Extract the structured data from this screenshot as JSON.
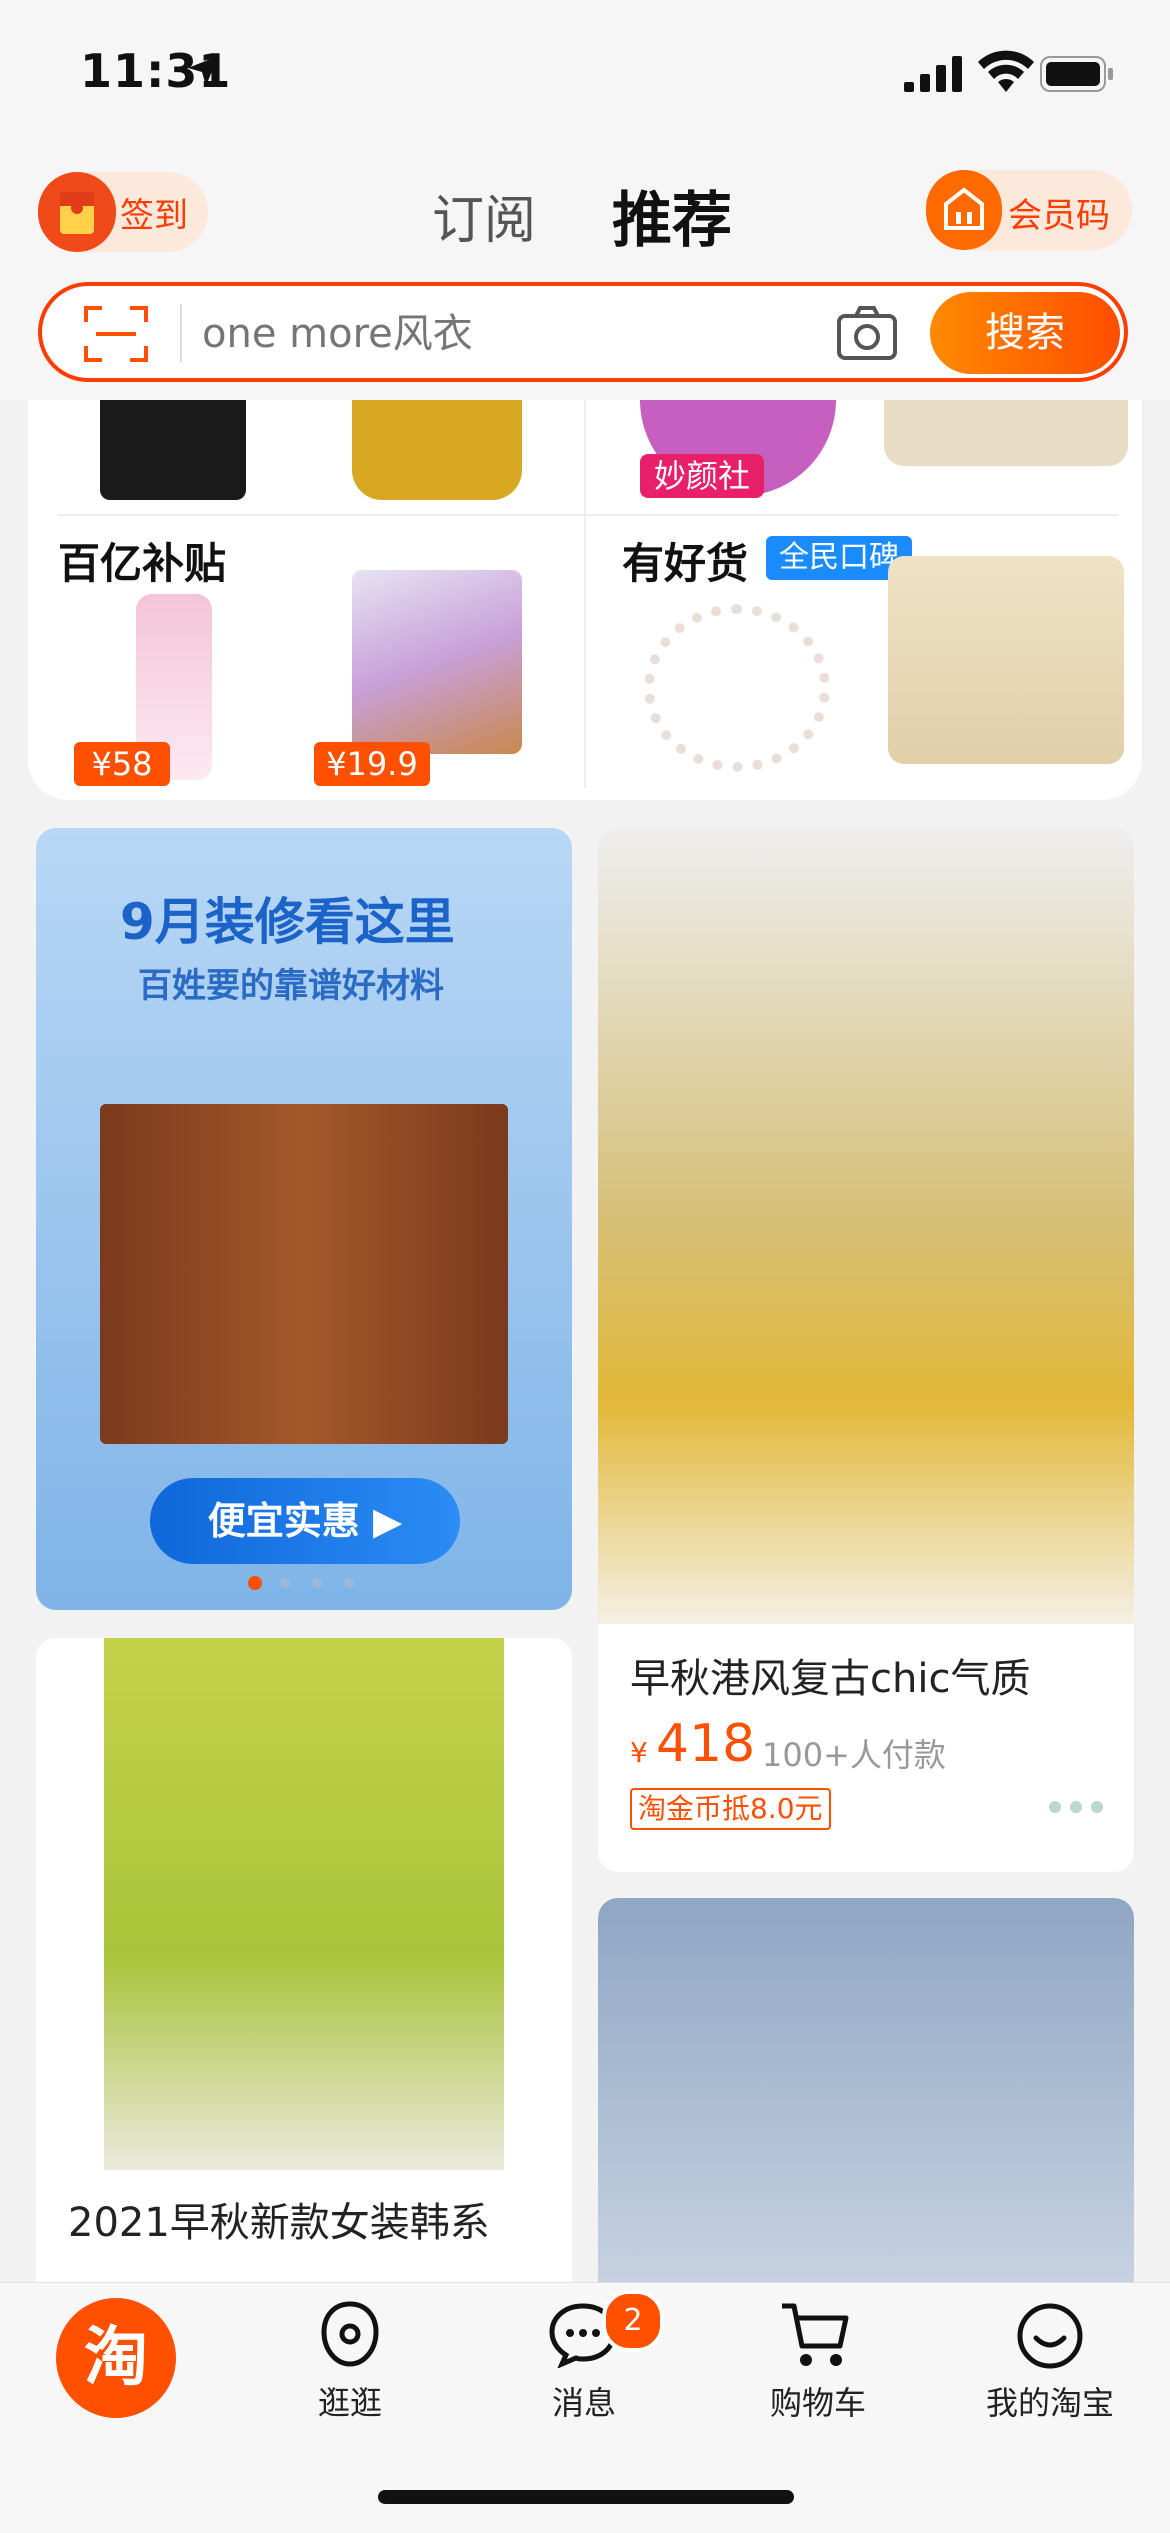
{
  "status_bar": {
    "time": "11:31"
  },
  "header": {
    "sign_in_label": "签到",
    "tabs": [
      {
        "label": "订阅"
      },
      {
        "label": "推荐"
      }
    ],
    "member_code_label": "会员码"
  },
  "search": {
    "placeholder": "one more风衣",
    "button_label": "搜索"
  },
  "top_sections": {
    "miaoyan_badge": "妙颜社",
    "subsidy": {
      "title": "百亿补贴",
      "prices": [
        "¥58",
        "¥19.9"
      ]
    },
    "good_goods": {
      "title": "有好货",
      "badge": "全民口碑"
    }
  },
  "banner": {
    "title": "9月装修看这里",
    "subtitle": "百姓要的靠谱好材料",
    "button_label": "便宜实惠"
  },
  "products": [
    {
      "title": "早秋港风复古chic气质",
      "currency": "¥",
      "price": "418",
      "paid_count": "100+人付款",
      "coupon": "淘金币抵8.0元"
    },
    {
      "title": "2021早秋新款女装韩系"
    }
  ],
  "tab_bar": {
    "items": [
      {
        "label": "逛逛"
      },
      {
        "label": "消息",
        "badge": "2"
      },
      {
        "label": "购物车"
      },
      {
        "label": "我的淘宝"
      }
    ],
    "home_glyph": "淘"
  },
  "colors": {
    "accent": "#ff5000",
    "brand_orange": "#ff6a00",
    "blue": "#1a8cff"
  }
}
